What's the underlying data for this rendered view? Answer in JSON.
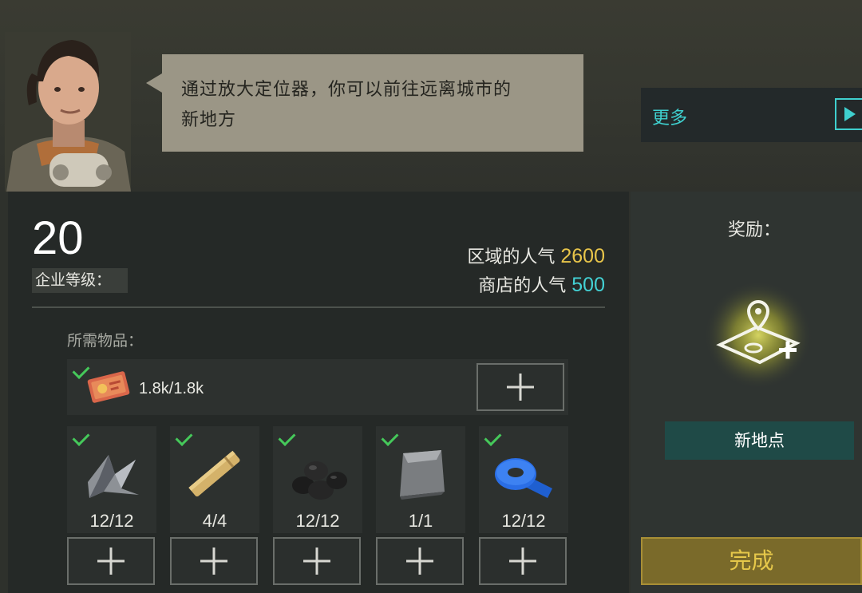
{
  "dialog": {
    "text_line1": "通过放大定位器，你可以前往远离城市的",
    "text_line2": "新地方"
  },
  "more_button": {
    "label": "更多"
  },
  "company": {
    "level": "20",
    "level_label": "企业等级："
  },
  "popularity": {
    "area_label": "区域的人气",
    "area_value": "2600",
    "shop_label": "商店的人气",
    "shop_value": "500"
  },
  "required": {
    "label": "所需物品：",
    "money": {
      "count": "1.8k/1.8k",
      "icon": "money-ticket-icon",
      "done": true
    },
    "items": [
      {
        "icon": "metal-scrap-icon",
        "count": "12/12",
        "done": true
      },
      {
        "icon": "wood-plank-icon",
        "count": "4/4",
        "done": true
      },
      {
        "icon": "coal-icon",
        "count": "12/12",
        "done": true
      },
      {
        "icon": "metal-plate-icon",
        "count": "1/1",
        "done": true
      },
      {
        "icon": "blue-tape-icon",
        "count": "12/12",
        "done": true
      }
    ]
  },
  "reward": {
    "title": "奖励：",
    "icon": "map-pin-plus-icon",
    "name": "新地点"
  },
  "complete_button": {
    "label": "完成"
  },
  "colors": {
    "accent_cyan": "#3fd0cf",
    "popularity_yellow": "#e8c54a",
    "popularity_cyan": "#43d1d4",
    "check_green": "#45c85a",
    "complete_gold": "#e6c84a"
  }
}
